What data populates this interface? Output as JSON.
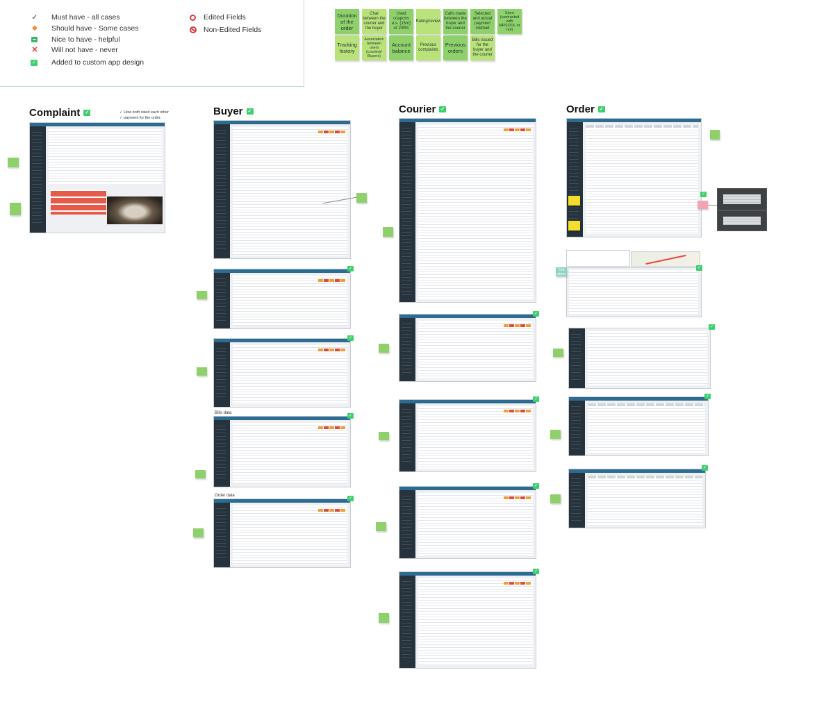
{
  "legend": {
    "items": [
      {
        "icon": "check-icon",
        "label": "Must have - all cases"
      },
      {
        "icon": "diamond-icon",
        "label": "Should have - Some cases"
      },
      {
        "icon": "nice-icon",
        "label": "Nice to have - helpful"
      },
      {
        "icon": "cross-icon",
        "label": "Will not have - never"
      },
      {
        "icon": "added-check-icon",
        "label": "Added to custom app design"
      }
    ],
    "fields": [
      {
        "icon": "ring-icon",
        "label": "Edited Fields"
      },
      {
        "icon": "ban-icon",
        "label": "Non-Edited Fields"
      }
    ]
  },
  "top_stickies": [
    {
      "text": "Duration of the order",
      "color": "#8ed16a"
    },
    {
      "text": "Chat between the courier and the buyer",
      "color": "#b9e37a"
    },
    {
      "text": "Used coupons e.s. (15m) or 20RS",
      "color": "#8ed16a"
    },
    {
      "text": "Rating/review",
      "color": "#b9e37a"
    },
    {
      "text": "Calls made between the buyer and the courier",
      "color": "#8ed16a"
    },
    {
      "text": "Selected and actual payment method",
      "color": "#8ed16a"
    },
    {
      "text": "Store (contracted with MRSOOL or not)",
      "color": "#8ed16a"
    },
    {
      "text": "Tracking history",
      "color": "#b9e37a"
    },
    {
      "text": "Association between users (couriers/ Buyers)",
      "color": "#b9e37a"
    },
    {
      "text": "Account balance",
      "color": "#8ed16a"
    },
    {
      "text": "Previous complaints",
      "color": "#b9e37a"
    },
    {
      "text": "Previous orders",
      "color": "#8ed16a"
    },
    {
      "text": "Bills issued for the buyer and the courier",
      "color": "#b9e37a"
    }
  ],
  "sections": {
    "complaint": "Complaint",
    "buyer": "Buyer",
    "courier": "Courier",
    "order": "Order"
  },
  "complaint_notes": [
    "How both rated each other",
    "payment for the order."
  ],
  "captions": {
    "bills_data": "Bills data",
    "order_data": "Order data"
  },
  "side_stickies": {
    "order_highlight": "The store"
  },
  "colors": {
    "accent": "#3ecf6e",
    "sticky_green": "#8ed16a",
    "sticky_lime": "#b9e37a",
    "sticky_yellow": "#f5dd2b",
    "sticky_teal": "#8fd3c8",
    "sticky_pink": "#f2a5b0",
    "topbar": "#2c6c93",
    "sidebar": "#26333c"
  }
}
